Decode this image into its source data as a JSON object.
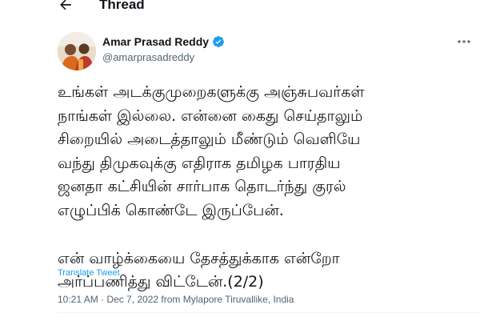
{
  "header": {
    "title": "Thread",
    "back_icon": "arrow-left-icon"
  },
  "tweet": {
    "author": {
      "name": "Amar Prasad Reddy",
      "handle": "@amarprasadreddy",
      "verified": true,
      "verified_color": "#1d9bf0"
    },
    "more_icon": "more-horizontal-icon",
    "body": {
      "paragraph1": [
        "உங்கள் அடக்குமுறைகளுக்கு அஞ்சுபவர்கள்",
        "நாங்கள் இல்லை. என்னை கைது செய்தாலும்",
        "சிறையில் அடைத்தாலும் மீண்டும் வெளியே",
        "வந்து திமுகவுக்கு எதிராக தமிழக பாரதிய",
        "ஜனதா கட்சியின் சார்பாக தொடர்ந்து குரல்",
        "எழுப்பிக் கொண்டே இருப்பேன்."
      ],
      "paragraph2": [
        "என் வாழ்க்கையை தேசத்துக்காக என்றோ",
        "அர்ப்பணித்து விட்டேன்.(2/2)"
      ]
    },
    "translate_label": "Translate Tweet",
    "timestamp": "10:21 AM · Dec 7, 2022 from Mylapore Tiruvallike, India"
  },
  "colors": {
    "text": "#0f1419",
    "secondary": "#536471",
    "link": "#1d9bf0"
  }
}
